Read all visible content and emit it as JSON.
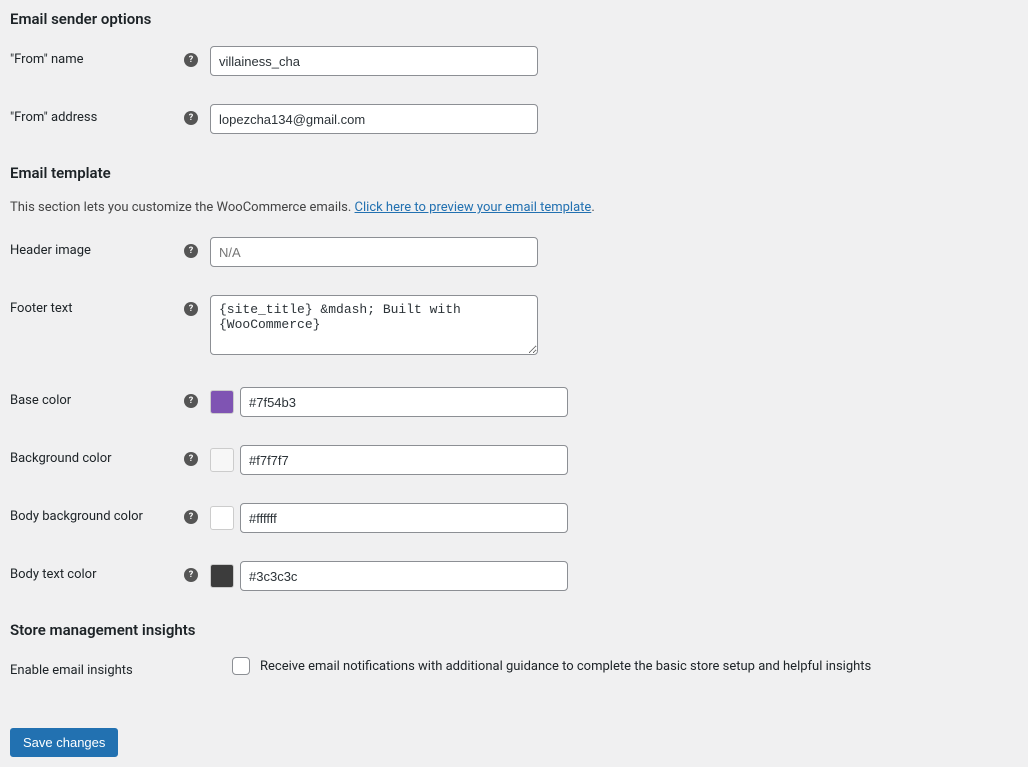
{
  "sender": {
    "heading": "Email sender options",
    "from_name_label": "\"From\" name",
    "from_name_value": "villainess_cha",
    "from_address_label": "\"From\" address",
    "from_address_value": "lopezcha134@gmail.com"
  },
  "template": {
    "heading": "Email template",
    "description_prefix": "This section lets you customize the WooCommerce emails. ",
    "description_link": "Click here to preview your email template",
    "description_suffix": ".",
    "header_image_label": "Header image",
    "header_image_placeholder": "N/A",
    "footer_text_label": "Footer text",
    "footer_text_value": "{site_title} &mdash; Built with {WooCommerce}",
    "base_color_label": "Base color",
    "base_color": "#7f54b3",
    "background_color_label": "Background color",
    "background_color": "#f7f7f7",
    "body_bg_color_label": "Body background color",
    "body_bg_color": "#ffffff",
    "body_text_color_label": "Body text color",
    "body_text_color": "#3c3c3c"
  },
  "insights": {
    "heading": "Store management insights",
    "label": "Enable email insights",
    "description": "Receive email notifications with additional guidance to complete the basic store setup and helpful insights"
  },
  "buttons": {
    "save": "Save changes"
  },
  "help_glyph": "?"
}
